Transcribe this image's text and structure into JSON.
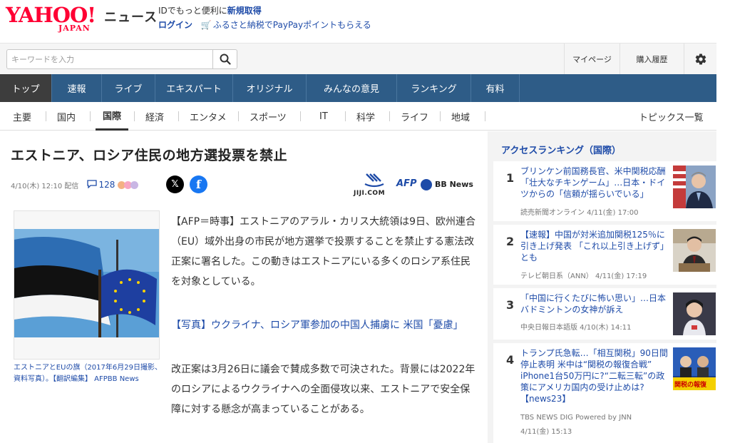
{
  "header": {
    "logo_main": "YAHOO!",
    "logo_sub": "JAPAN",
    "logo_news": "ニュース",
    "promo_prefix": "IDでもっと便利に",
    "promo_strong": "新規取得",
    "login": "ログイン",
    "furusato": "ふるさと納税でPayPayポイントもらえる"
  },
  "search": {
    "placeholder": "キーワードを入力",
    "mypage": "マイページ",
    "history": "購入履歴"
  },
  "global_nav": [
    {
      "label": "トップ",
      "active": true
    },
    {
      "label": "速報"
    },
    {
      "label": "ライブ"
    },
    {
      "label": "エキスパート"
    },
    {
      "label": "オリジナル"
    },
    {
      "label": "みんなの意見"
    },
    {
      "label": "ランキング"
    },
    {
      "label": "有料"
    }
  ],
  "sub_nav": [
    {
      "label": "主要"
    },
    {
      "label": "国内"
    },
    {
      "label": "国際",
      "active": true
    },
    {
      "label": "経済"
    },
    {
      "label": "エンタメ"
    },
    {
      "label": "スポーツ"
    },
    {
      "label": "IT"
    },
    {
      "label": "科学"
    },
    {
      "label": "ライフ"
    },
    {
      "label": "地域"
    }
  ],
  "sub_nav_topics": "トピックス一覧",
  "article": {
    "title": "エストニア、ロシア住民の地方選投票を禁止",
    "date": "4/10(木) 12:10 配信",
    "comments": "128",
    "jiji": "JIJI.COM",
    "afp": "AFP",
    "bbnews": "BB News",
    "photo_caption": "エストニアとEUの旗（2017年6月29日撮影、資料写真）。【翻訳編集】 AFPBB News",
    "paragraph1": "【AFP＝時事】エストニアのアラル・カリス大統領は9日、欧州連合（EU）域外出身の市民が地方選挙で投票することを禁止する憲法改正案に署名した。この動きはエストニアにいる多くのロシア系住民を対象としている。",
    "related_link": "【写真】ウクライナ、ロシア軍参加の中国人捕虜に 米国「憂慮」",
    "paragraph2": "改正案は3月26日に議会で賛成多数で可決された。背景には2022年のロシアによるウクライナへの全面侵攻以来、エストニアで安全保障に対する懸念が高まっていることがある。"
  },
  "sidebar": {
    "title": "アクセスランキング（国際）",
    "items": [
      {
        "rank": "1",
        "title": "ブリンケン前国務長官、米中関税応酬「壮大なチキンゲーム」…日本・ドイツからの「信頼が揺らいでいる」",
        "source": "読売新聞オンライン 4/11(金) 17:00"
      },
      {
        "rank": "2",
        "title": "【速報】中国が対米追加関税125％に引き上げ発表 「これ以上引き上げず」とも",
        "source": "テレビ朝日系（ANN） 4/11(金) 17:19"
      },
      {
        "rank": "3",
        "title": "「中国に行くたびに怖い思い」…日本バドミントンの女神が訴え",
        "source": "中央日報日本語版 4/10(木) 14:11"
      },
      {
        "rank": "4",
        "title": "トランプ氏急転…「相互関税」90日間停止表明 米中は“関税の報復合戦” iPhone1台50万円に?“二転三転”の政策にアメリカ国内の受け止めは?【news23】",
        "source": "TBS NEWS DIG Powered by JNN",
        "source2": "4/11(金) 15:13",
        "thumb_caption": "関税の報復"
      }
    ]
  },
  "colors": {
    "brand_red": "#ff0033",
    "nav_blue": "#2e5c87",
    "link_blue": "#1e4ba8",
    "active_tab": "#3d3d3d"
  }
}
